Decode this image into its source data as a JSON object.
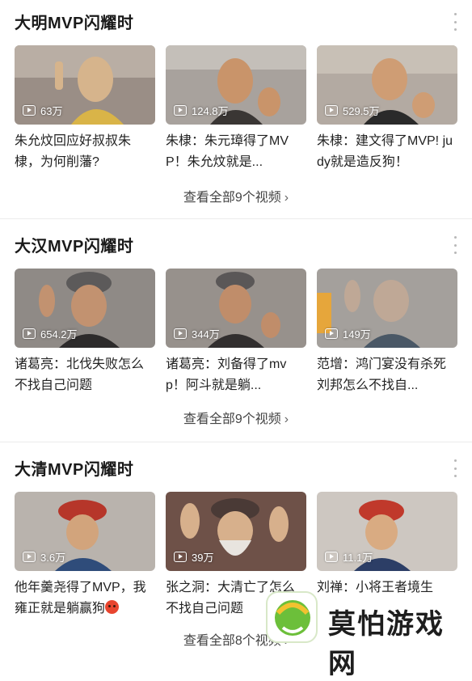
{
  "sections": [
    {
      "title": "大明MVP闪耀时",
      "view_all": "查看全部9个视频",
      "cards": [
        {
          "plays": "63万",
          "caption": "朱允炆回应好叔叔朱棣，为何削藩?"
        },
        {
          "plays": "124.8万",
          "caption": "朱棣：朱元璋得了MVP！朱允炆就是..."
        },
        {
          "plays": "529.5万",
          "caption": "朱棣：建文得了MVP! judy就是造反狗！"
        }
      ]
    },
    {
      "title": "大汉MVP闪耀时",
      "view_all": "查看全部9个视频",
      "cards": [
        {
          "plays": "654.2万",
          "caption": "诸葛亮：北伐失败怎么不找自己问题"
        },
        {
          "plays": "344万",
          "caption": "诸葛亮：刘备得了mvp！阿斗就是躺..."
        },
        {
          "plays": "149万",
          "caption": "范增：鸿门宴没有杀死刘邦怎么不找自..."
        }
      ]
    },
    {
      "title": "大清MVP闪耀时",
      "view_all": "查看全部8个视频",
      "cards": [
        {
          "plays": "3.6万",
          "caption": "他年羹尧得了MVP，我雍正就是躺赢狗"
        },
        {
          "plays": "39万",
          "caption": "张之洞：大清亡了怎么不找自己问题"
        },
        {
          "plays": "11.1万",
          "caption": "刘禅：小将王者境生"
        }
      ]
    }
  ],
  "icons": {
    "more": "more-vertical-icon",
    "play": "play-icon",
    "chevron": "chevron-right-icon"
  },
  "watermark": {
    "text": "莫怕游戏网"
  }
}
